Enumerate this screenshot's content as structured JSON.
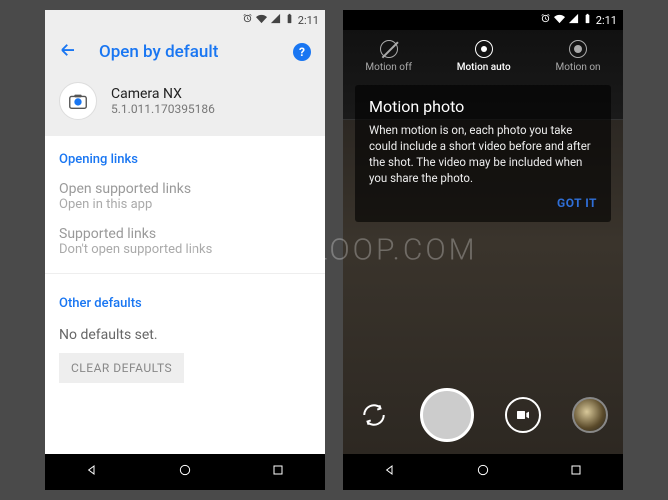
{
  "left": {
    "status_time": "2:11",
    "appbar_title": "Open by default",
    "app_name": "Camera NX",
    "app_version": "5.1.011.170395186",
    "section_opening": "Opening links",
    "pref_supported_title": "Open supported links",
    "pref_supported_sub": "Open in this app",
    "pref_links_title": "Supported links",
    "pref_links_sub": "Don't open supported links",
    "section_other": "Other defaults",
    "no_defaults": "No defaults set.",
    "clear_defaults": "CLEAR DEFAULTS"
  },
  "right": {
    "status_time": "2:11",
    "tabs": {
      "off": "Motion off",
      "auto": "Motion auto",
      "on": "Motion on"
    },
    "tooltip_title": "Motion photo",
    "tooltip_body": "When motion is on, each photo you take could include a short video before and after the shot. The video may be included when you share the photo.",
    "tooltip_action": "GOT IT"
  },
  "watermark": "CHROMLOOP.COM"
}
